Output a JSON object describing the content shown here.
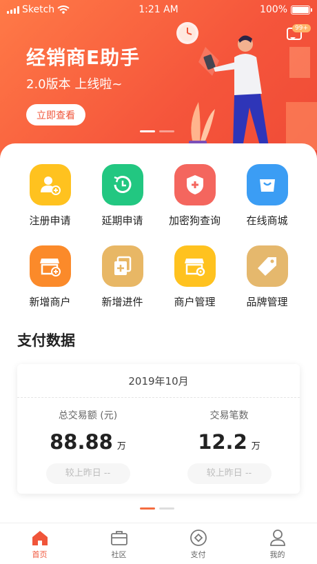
{
  "status_bar": {
    "carrier": "Sketch",
    "time": "1:21 AM",
    "battery": "100%"
  },
  "banner": {
    "title": "经销商E助手",
    "subtitle": "2.0版本 上线啦~",
    "button": "立即查看",
    "message_badge": "99+"
  },
  "grid": [
    {
      "label": "注册申请",
      "icon": "user-add-icon",
      "color": "#ffc21f"
    },
    {
      "label": "延期申请",
      "icon": "clock-icon",
      "color": "#22c781"
    },
    {
      "label": "加密狗查询",
      "icon": "shield-plus-icon",
      "color": "#f4665e"
    },
    {
      "label": "在线商城",
      "icon": "shopping-bag-icon",
      "color": "#3b9df4"
    },
    {
      "label": "新增商户",
      "icon": "store-add-icon",
      "color": "#fb8a2a"
    },
    {
      "label": "新增进件",
      "icon": "document-add-icon",
      "color": "#e8b765"
    },
    {
      "label": "商户管理",
      "icon": "store-settings-icon",
      "color": "#ffc21f"
    },
    {
      "label": "品牌管理",
      "icon": "tag-icon",
      "color": "#e5b86d"
    }
  ],
  "payment": {
    "section_title": "支付数据",
    "month": "2019年10月",
    "total_amount": {
      "label": "总交易额 (元)",
      "value": "88.88",
      "unit": "万",
      "compare": "较上昨日 --"
    },
    "transactions": {
      "label": "交易笔数",
      "value": "12.2",
      "unit": "万",
      "compare": "较上昨日 --"
    }
  },
  "tabs": [
    {
      "label": "首页",
      "icon": "home-icon"
    },
    {
      "label": "社区",
      "icon": "briefcase-icon"
    },
    {
      "label": "支付",
      "icon": "pay-icon"
    },
    {
      "label": "我的",
      "icon": "profile-icon"
    }
  ],
  "colors": {
    "accent": "#f0553a",
    "hero_start": "#ff7a47",
    "hero_end": "#ef4b36"
  }
}
